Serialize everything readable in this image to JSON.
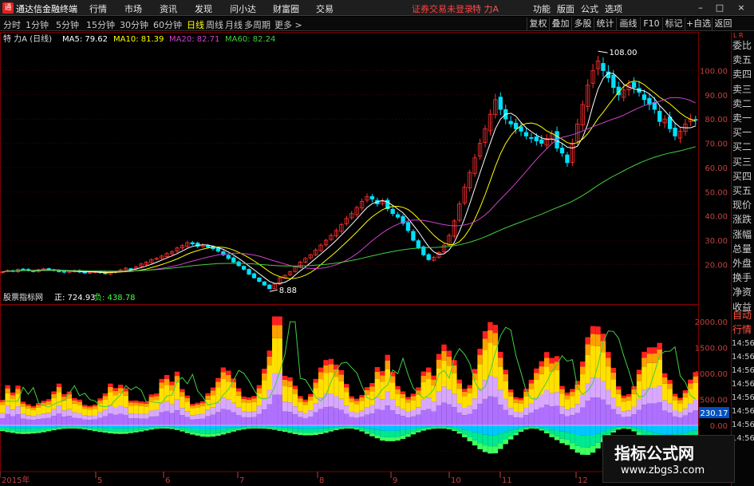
{
  "window": {
    "app_title": "通达信金融终端",
    "logo_text": "通",
    "menu": [
      "行情",
      "市场",
      "资讯",
      "发现",
      "问小达",
      "财富圈",
      "交易"
    ],
    "notice": "证券交易未登录",
    "stock_tag": "特 力A",
    "right_menu": [
      "功能",
      "版面",
      "公式",
      "选项"
    ],
    "window_buttons": [
      "–",
      "□",
      "×"
    ]
  },
  "toolbar": {
    "periods": [
      "分时",
      "1分钟",
      "5分钟",
      "15分钟",
      "30分钟",
      "60分钟",
      "日线",
      "周线",
      "月线",
      "多周期",
      "更多 >"
    ],
    "active_period": "日线",
    "buttons": [
      "复权",
      "叠加",
      "多股",
      "统计",
      "画线",
      "F10",
      "标记",
      "+自选",
      "返回"
    ]
  },
  "panel": {
    "top": "L R",
    "items": [
      "委比",
      "卖五",
      "卖四",
      "卖三",
      "卖二",
      "卖一",
      "买一",
      "买二",
      "买三",
      "买四",
      "买五",
      "现价",
      "涨跌",
      "涨幅",
      "总量",
      "外盘",
      "换手",
      "净资",
      "收益"
    ],
    "items2": [
      "自动",
      "行情"
    ],
    "clock": [
      "14:56",
      "14:56",
      "14:56",
      "14:56",
      "14:56",
      "14:56",
      "14:56",
      "14:56"
    ]
  },
  "main_chart": {
    "legend": {
      "title": "特 力A (日线)",
      "ma": [
        {
          "name": "MA5",
          "value": "79.62",
          "color": "#ffffff"
        },
        {
          "name": "MA10",
          "value": "81.39",
          "color": "#ffff00"
        },
        {
          "name": "MA20",
          "value": "82.71",
          "color": "#d040d0"
        },
        {
          "name": "MA60",
          "value": "82.24",
          "color": "#40d040"
        }
      ]
    },
    "high_label": "108.00",
    "low_label": "8.88"
  },
  "sub_chart": {
    "legend": {
      "title": "股票指标网",
      "pos_label": "正: 724.93",
      "neg_label": "负: 438.78"
    },
    "value_badge": "230.17"
  },
  "x_axis": {
    "labels": [
      "2015年",
      "5",
      "6",
      "7",
      "8",
      "9",
      "10",
      "11",
      "12"
    ]
  },
  "colors": {
    "up": "#ff3030",
    "down": "#00e0ff",
    "grid": "#7a0000",
    "axis_text": "#c04040"
  },
  "watermark": {
    "line1": "指标公式网",
    "line2": "www.zbgs3.com"
  },
  "chart_data": {
    "type": "candlestick",
    "price_axis": {
      "ticks": [
        20,
        30,
        40,
        50,
        60,
        70,
        80,
        90,
        100
      ],
      "ylim": [
        5,
        112
      ]
    },
    "indicator_axis": {
      "ticks": [
        2000,
        1500,
        1000,
        500,
        0,
        -500
      ],
      "ylim": [
        -800,
        2200
      ]
    },
    "close": [
      17,
      17.5,
      17.2,
      18,
      17.8,
      17.5,
      17.2,
      17.8,
      18.2,
      18,
      17.6,
      17,
      16.8,
      17.2,
      17.5,
      16.9,
      16.5,
      16.8,
      17,
      16.6,
      16.2,
      16.8,
      17.2,
      17.8,
      18.5,
      18.2,
      19,
      20.2,
      21,
      22,
      22.5,
      23.5,
      24.5,
      25.2,
      26.8,
      27.8,
      29,
      28.5,
      27.5,
      28,
      27.2,
      26.5,
      25.5,
      24,
      22.5,
      21,
      19.5,
      18,
      16,
      14.5,
      13,
      11.5,
      10,
      12,
      14.5,
      15.5,
      17,
      19,
      21,
      22.5,
      24,
      26,
      28,
      30,
      32,
      34,
      36.5,
      39,
      41,
      43.5,
      46,
      48,
      47,
      45,
      46,
      43,
      41,
      39.5,
      37,
      34,
      30,
      27,
      24,
      22,
      23,
      25,
      28,
      32,
      38,
      45,
      52,
      58,
      64,
      70,
      76,
      82,
      88,
      84,
      80,
      78,
      76,
      75,
      73,
      72,
      71,
      70,
      72,
      74,
      68,
      66,
      62,
      70,
      78,
      86,
      94,
      100,
      104,
      100,
      97,
      93,
      90,
      92,
      94,
      93,
      91,
      88,
      86,
      84,
      79,
      80,
      76,
      73,
      75,
      78,
      80,
      79.6
    ],
    "ma": {
      "MA5": {
        "color": "#ffffff"
      },
      "MA10": {
        "color": "#ffff00"
      },
      "MA20": {
        "color": "#d040d0"
      },
      "MA60": {
        "color": "#40d040"
      }
    },
    "annotations": [
      {
        "text": "108.00",
        "type": "high"
      },
      {
        "text": "8.88",
        "type": "low"
      }
    ]
  }
}
